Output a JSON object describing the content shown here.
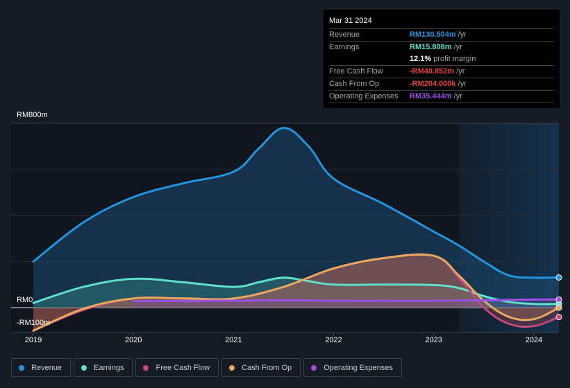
{
  "tooltip": {
    "date": "Mar 31 2024",
    "rows": [
      {
        "label": "Revenue",
        "value": "RM130.504m",
        "unit": "/yr",
        "color": "#2394df"
      },
      {
        "label": "Earnings",
        "value": "RM15.808m",
        "unit": "/yr",
        "color": "#5ee0cd"
      },
      {
        "label": "",
        "value": "12.1%",
        "unit": "profit margin",
        "color": "#ffffff"
      },
      {
        "label": "Free Cash Flow",
        "value": "-RM40.852m",
        "unit": "/yr",
        "color": "#e64141"
      },
      {
        "label": "Cash From Op",
        "value": "-RM204.000k",
        "unit": "/yr",
        "color": "#e64141"
      },
      {
        "label": "Operating Expenses",
        "value": "RM35.444m",
        "unit": "/yr",
        "color": "#9d4fe6"
      }
    ]
  },
  "legend": [
    {
      "label": "Revenue",
      "color": "#2394df"
    },
    {
      "label": "Earnings",
      "color": "#5ee0cd"
    },
    {
      "label": "Free Cash Flow",
      "color": "#c4487e"
    },
    {
      "label": "Cash From Op",
      "color": "#e8a95e"
    },
    {
      "label": "Operating Expenses",
      "color": "#9d4fe6"
    }
  ],
  "chart_data": {
    "type": "area",
    "title": "",
    "xlabel": "",
    "ylabel": "",
    "y_tick_labels": [
      "RM800m",
      "RM0",
      "-RM100m"
    ],
    "x_tick_labels": [
      "2019",
      "2020",
      "2021",
      "2022",
      "2023",
      "2024"
    ],
    "ylim": [
      -100,
      800
    ],
    "xlim": [
      2019.0,
      2024.25
    ],
    "grid": true,
    "forecast_shade_start": 2023.25,
    "legend_position": "bottom",
    "series": [
      {
        "name": "Revenue",
        "color": "#2394df",
        "x": [
          2019.0,
          2019.5,
          2020.0,
          2020.5,
          2021.0,
          2021.25,
          2021.5,
          2021.75,
          2022.0,
          2022.5,
          2023.0,
          2023.25,
          2023.5,
          2023.75,
          2024.0,
          2024.25
        ],
        "y": [
          200,
          370,
          480,
          540,
          590,
          690,
          780,
          700,
          560,
          450,
          330,
          270,
          200,
          140,
          130,
          131
        ]
      },
      {
        "name": "Earnings",
        "color": "#5ee0cd",
        "x": [
          2019.0,
          2019.5,
          2020.0,
          2020.5,
          2021.0,
          2021.25,
          2021.5,
          2021.75,
          2022.0,
          2022.5,
          2023.0,
          2023.25,
          2023.5,
          2023.75,
          2024.0,
          2024.25
        ],
        "y": [
          20,
          90,
          125,
          110,
          90,
          110,
          130,
          115,
          100,
          100,
          98,
          85,
          50,
          25,
          16,
          16
        ]
      },
      {
        "name": "Free Cash Flow",
        "color": "#c4487e",
        "x": [
          2019.0,
          2019.5,
          2020.0,
          2020.5,
          2021.0,
          2021.5,
          2022.0,
          2022.5,
          2023.0,
          2023.25,
          2023.5,
          2023.75,
          2024.0,
          2024.25
        ],
        "y": [
          -100,
          -10,
          40,
          40,
          40,
          90,
          170,
          215,
          225,
          130,
          0,
          -70,
          -80,
          -41
        ]
      },
      {
        "name": "Cash From Op",
        "color": "#e8a95e",
        "x": [
          2019.0,
          2019.5,
          2020.0,
          2020.5,
          2021.0,
          2021.5,
          2022.0,
          2022.5,
          2023.0,
          2023.25,
          2023.5,
          2023.75,
          2024.0,
          2024.25
        ],
        "y": [
          -100,
          -5,
          40,
          40,
          40,
          90,
          170,
          215,
          225,
          140,
          30,
          -40,
          -50,
          0
        ]
      },
      {
        "name": "Operating Expenses",
        "color": "#9d4fe6",
        "x": [
          2020.0,
          2020.5,
          2021.0,
          2021.5,
          2022.0,
          2022.5,
          2023.0,
          2023.5,
          2024.0,
          2024.25
        ],
        "y": [
          28,
          29,
          30,
          32,
          30,
          30,
          30,
          32,
          35,
          35
        ]
      }
    ]
  }
}
